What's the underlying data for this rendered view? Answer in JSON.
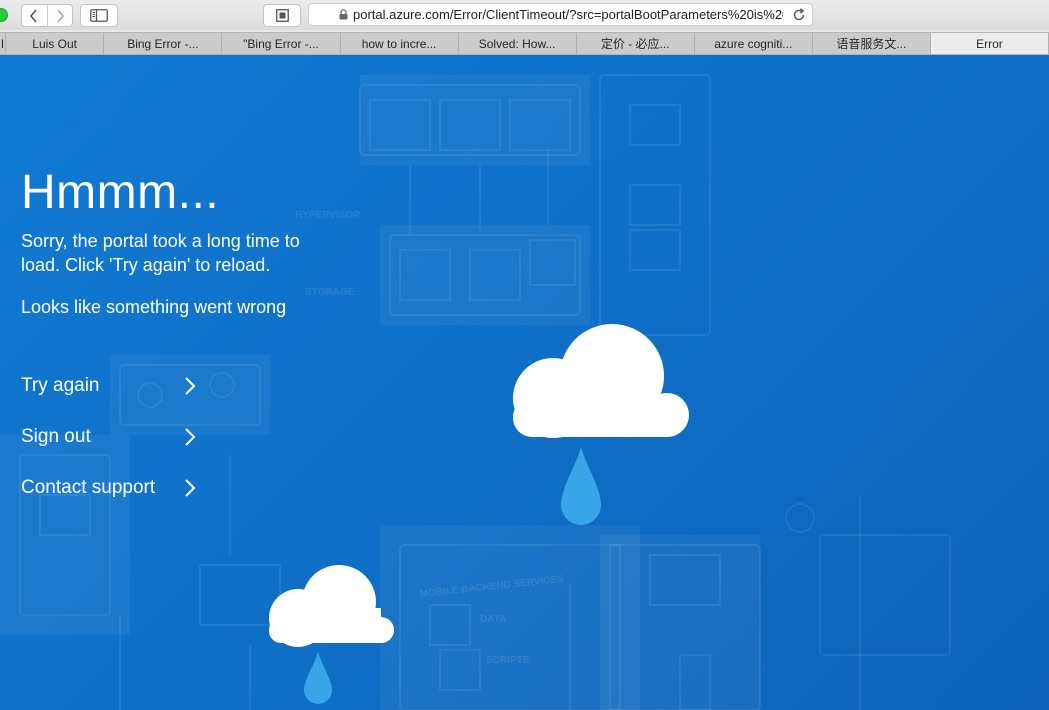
{
  "browser": {
    "url": "portal.azure.com/Error/ClientTimeout/?src=portalBootParameters%20is%20",
    "tabs": [
      {
        "label": "l",
        "active": false
      },
      {
        "label": "Luis Out",
        "active": false
      },
      {
        "label": "Bing Error -...",
        "active": false
      },
      {
        "label": "\"Bing Error -...",
        "active": false
      },
      {
        "label": "how to incre...",
        "active": false
      },
      {
        "label": "Solved: How...",
        "active": false
      },
      {
        "label": "定价 - 必应...",
        "active": false
      },
      {
        "label": "azure cogniti...",
        "active": false
      },
      {
        "label": "语音服务文...",
        "active": false
      },
      {
        "label": "Error",
        "active": true
      }
    ]
  },
  "error_page": {
    "headline": "Hmmm...",
    "message": "Sorry, the portal took a long time to load. Click 'Try again' to reload.",
    "submessage": "Looks like something went wrong",
    "actions": [
      {
        "label": "Try again",
        "icon": "chevron-right-icon"
      },
      {
        "label": "Sign out",
        "icon": "chevron-right-icon"
      },
      {
        "label": "Contact support",
        "icon": "chevron-right-icon"
      }
    ]
  },
  "colors": {
    "page_background": "#0f6fc6",
    "cloud": "#ffffff",
    "raindrop": "#3aa4e8"
  }
}
